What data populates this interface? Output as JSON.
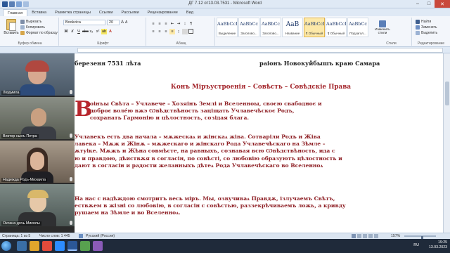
{
  "window": {
    "title": "ДГ 7.12 от13.03.7531 - Microsoft Word",
    "controls": {
      "minimize": "–",
      "maximize": "□",
      "close": "✕"
    }
  },
  "ribbon": {
    "tabs": [
      {
        "label": "Главная",
        "active": true
      },
      {
        "label": "Вставка"
      },
      {
        "label": "Разметка страницы"
      },
      {
        "label": "Ссылки"
      },
      {
        "label": "Рассылки"
      },
      {
        "label": "Рецензирование"
      },
      {
        "label": "Вид"
      }
    ],
    "clipboard": {
      "paste": "Вставить",
      "cut": "Вырезать",
      "copy": "Копировать",
      "format_painter": "Формат по образцу",
      "group_label": "Буфер обмена"
    },
    "font": {
      "family": "Bookvica",
      "size": "20",
      "group_label": "Шрифт",
      "bold": "Ж",
      "italic": "К",
      "underline": "Ч"
    },
    "paragraph": {
      "group_label": "Абзац"
    },
    "styles": {
      "items": [
        {
          "sample": "AaBbCcI",
          "name": "Выделение"
        },
        {
          "sample": "AaBbCc",
          "name": "Заголово..."
        },
        {
          "sample": "AaBbCc",
          "name": "Заголово..."
        },
        {
          "sample": "AaB",
          "name": "Название"
        },
        {
          "sample": "AaBbCcDc",
          "name": "¶ Обычный",
          "selected": true
        },
        {
          "sample": "AaBbCcDc",
          "name": "¶ Обычный"
        },
        {
          "sample": "AaBbCc",
          "name": "Подзагол..."
        }
      ],
      "change_styles": "Изменить стили",
      "group_label": "Стили"
    },
    "editing": {
      "find": "Найти",
      "replace": "Заменить",
      "select": "Выделить",
      "group_label": "Редактирование"
    }
  },
  "participants": [
    {
      "name": "Людмила"
    },
    {
      "name": "Виктор сынъ Петра"
    },
    {
      "name": "Надежда Родъ-Михаила"
    },
    {
      "name": "Оксана дочь Миколы"
    }
  ],
  "document": {
    "header_left": "березеня 7531 лѣта",
    "header_right": "раіонъ Новокуйбышъ краю Самара",
    "heading": "Конъ Міръустроенія – Совѣсть – Совѣдскіе Права",
    "drop_cap": "В",
    "paragraphs": [
      [
        "оінъы Свѣта – Учлавече – Хозяінъ Землі и Вселенноы, своєю свабодноє и",
        "доброє воле́ю вжэ Ѡвѣдствѣность заціщать Учлавечѣскоє Родъ,",
        "сохранать Гармонію и цѣлостность, созідая блага."
      ],
      [
        "Учлавекъ есть два начала – мѫжескаѧ и жінскаѧ жіва. Сотваріли Родъ и Жіва",
        "лавека – Мѫж и Жінѫ – мѫжескаго и жінскаго Рода Учлавечѣскаго  на Зѣмле –",
        "ѫтуіке. Мѫжъ и Жѣна совмѣсте, на равныхъ, сознавая всю Ѡвѣдствѣность, ида с",
        "ю и правдою, дѣиствѫя в согласін, по совѣсті, со любовію образуютъ цѣлостность и",
        "дают в согласін и радости желанныхъ дѣтеѧ Рода Учлавечѣскаго во Вселенноѧ"
      ],
      [
        "На нас с надѣждою смотритъ весь міръ. Мы, озвучиваѧ Правдѫ, ізлучаемъ Свѣтъ,",
        "ествѫем в жізні со любовію, в согласін с совѣстью, раззекрѣчиваемъ ложь, а кривду",
        "рушаем на Зѣмле и во Вселенноѧ."
      ]
    ]
  },
  "statusbar": {
    "page": "Страница: 1 из 5",
    "words": "Число слов: 1 445",
    "language": "Русский (Россия)",
    "zoom": "157%",
    "zoom_value": 157
  },
  "taskbar": {
    "lang": "RU",
    "time": "19:25",
    "date": "13.03.2023"
  },
  "colors": {
    "accent_red": "#a3242a",
    "ribbon_bg": "#f3f6fb",
    "title_bg": "#dfe9f5",
    "taskbar_bg": "#1f2a3a"
  }
}
